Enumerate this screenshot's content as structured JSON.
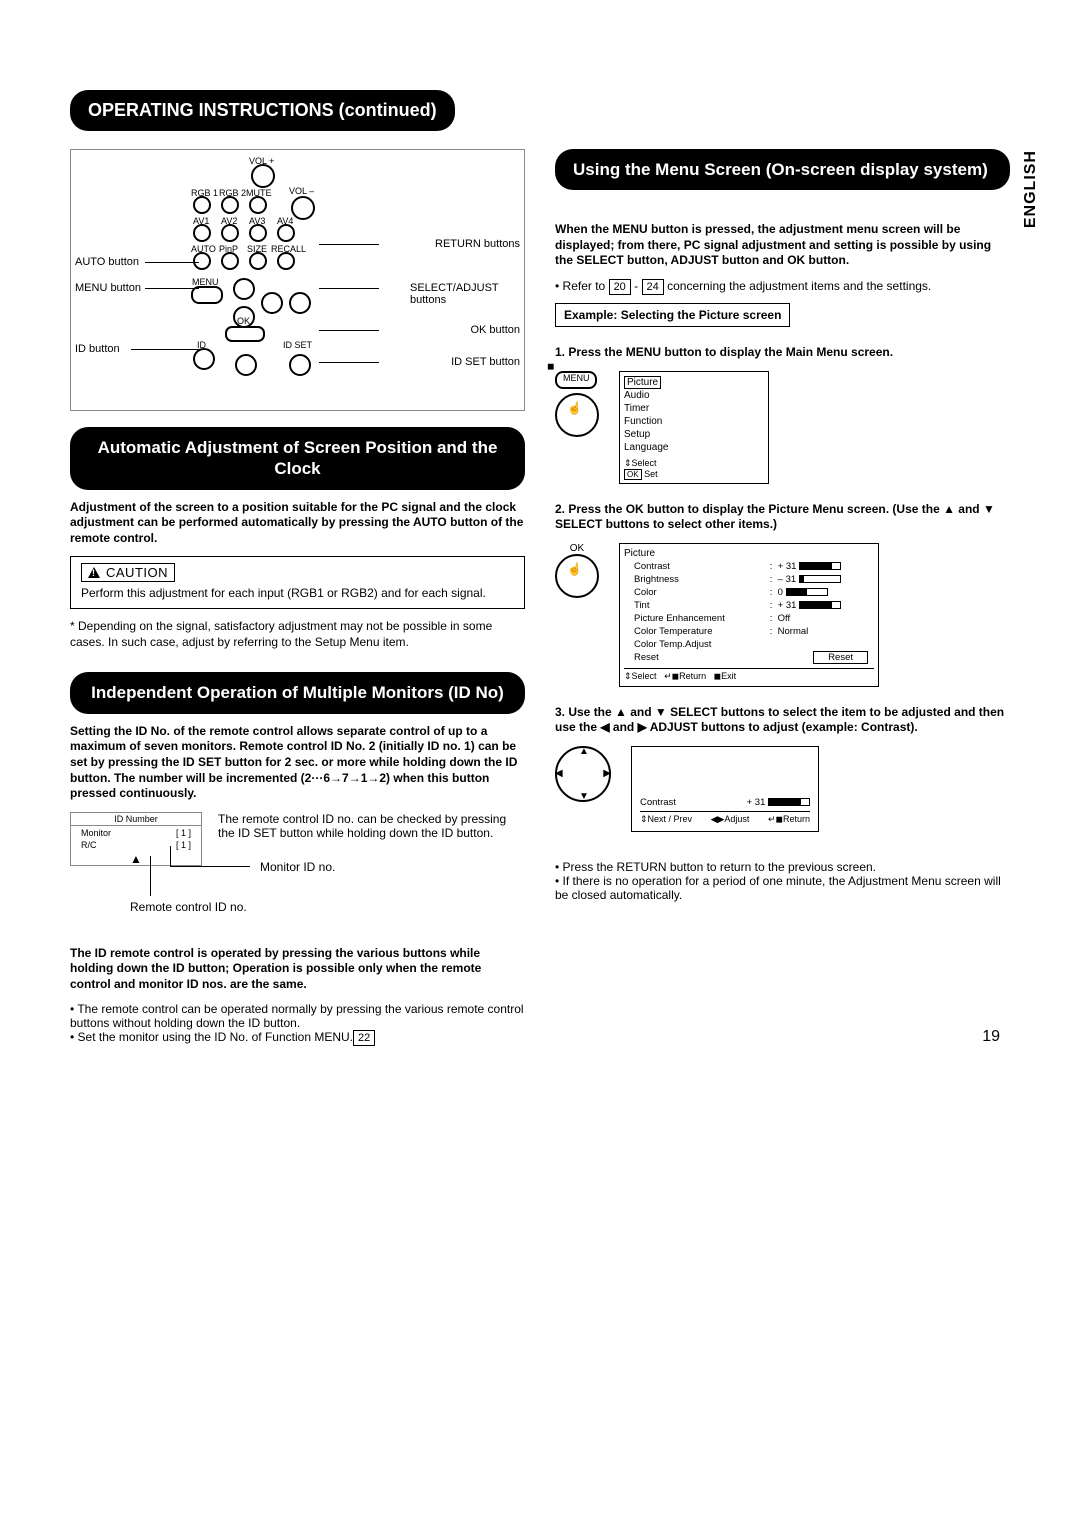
{
  "title": "OPERATING INSTRUCTIONS (continued)",
  "english_tab": "ENGLISH",
  "page_number": "19",
  "remote_labels": {
    "auto": "AUTO button",
    "menu": "MENU button",
    "id": "ID button",
    "return": "RETURN buttons",
    "select_adjust": "SELECT/ADJUST buttons",
    "ok": "OK button",
    "idset": "ID SET button",
    "btn_rgb1": "RGB 1",
    "btn_rgb2": "RGB 2",
    "btn_mute": "MUTE",
    "btn_av1": "AV1",
    "btn_av2": "AV2",
    "btn_av3": "AV3",
    "btn_av4": "AV4",
    "btn_auto": "AUTO",
    "btn_pinp": "PinP",
    "btn_size": "SIZE",
    "btn_recall": "RECALL",
    "btn_volp": "VOL +",
    "btn_volm": "VOL –",
    "btn_menu": "MENU",
    "btn_ok": "OK",
    "btn_id": "ID",
    "btn_idset": "ID SET"
  },
  "section_auto": {
    "heading": "Automatic Adjustment of Screen Position and the Clock",
    "intro": "Adjustment of the screen to a position suitable for the PC signal and the clock adjustment can be performed automatically by pressing the AUTO button of the remote control.",
    "caution_label": "CAUTION",
    "caution_body": "Perform this adjustment for each input (RGB1 or RGB2) and for each signal.",
    "note": "* Depending on the signal, satisfactory adjustment may not be possible in some cases. In such case, adjust by referring to the Setup Menu item."
  },
  "section_id": {
    "heading": "Independent Operation of Multiple Monitors (ID No)",
    "body1": "Setting the ID No. of the remote control allows separate control of up to a maximum of seven monitors. Remote control ID No. 2 (initially ID no. 1) can be set by pressing the ID SET button for 2 sec. or more while holding down the ID button.  The number will be incremented (2···6→7→1→2) when this button pressed continuously.",
    "check_text": "The remote control ID no. can be checked by pressing the ID SET button while holding down the ID button.",
    "idbox": {
      "title": "ID Number",
      "monitor": "Monitor",
      "rc": "R/C",
      "mval": "[ 1 ]",
      "rval": "[ 1 ]"
    },
    "mon_label": "Monitor ID no.",
    "rc_label": "Remote control ID no.",
    "body2": "The ID remote control is operated by pressing the various buttons while holding down the ID button; Operation is possible only when the remote control and monitor ID nos. are the same.",
    "bullet1": "The remote control can be operated normally by pressing the various remote control buttons without holding down the ID button.",
    "bullet2a": "Set the monitor using the ID No. of Function MENU.",
    "bullet2_ref": "22"
  },
  "section_menu": {
    "heading": "Using the Menu Screen (On-screen display system)",
    "intro": "When the MENU button is pressed, the adjustment menu screen will be displayed; from there, PC signal adjustment and setting is possible by using the SELECT button, ADJUST button and OK button.",
    "refer_a": "• Refer to ",
    "ref1": "20",
    "ref_dash": " - ",
    "ref2": "24",
    "refer_b": " concerning the adjustment items and the settings.",
    "example": "Example: Selecting the Picture screen",
    "step1": "1. Press the MENU button to display the Main Menu screen.",
    "menu_label": "MENU",
    "main_menu": [
      "Picture",
      "Audio",
      "Timer",
      "Function",
      "Setup",
      "Language"
    ],
    "main_footer_select": "Select",
    "main_footer_ok": "OK",
    "main_footer_set": " Set",
    "step2": "2. Press the OK button to display the Picture Menu screen. (Use the ▲ and ▼ SELECT buttons to select other items.)",
    "ok_label": "OK",
    "picture_menu": {
      "title": "Picture",
      "rows": [
        {
          "l": "Contrast",
          "v": "+ 31",
          "bar": 0.8
        },
        {
          "l": "Brightness",
          "v": "– 31",
          "bar": 0.1
        },
        {
          "l": "Color",
          "v": "0",
          "bar": 0.5
        },
        {
          "l": "Tint",
          "v": "+ 31",
          "bar": 0.8
        },
        {
          "l": "Picture Enhancement",
          "v": "Off"
        },
        {
          "l": "Color Temperature",
          "v": "Normal"
        },
        {
          "l": "Color Temp.Adjust",
          "v": ""
        },
        {
          "l": "Reset",
          "v": "",
          "reset": true
        }
      ],
      "footer_select": "Select",
      "footer_return": "Return",
      "footer_exit": "Exit"
    },
    "step3": "3. Use the ▲ and ▼ SELECT buttons to select the item to be adjusted and then use the ◀ and ▶ ADJUST buttons to adjust (example: Contrast).",
    "contrast_screen": {
      "label": "Contrast",
      "value": "+ 31",
      "np": "Next / Prev",
      "adj": "Adjust",
      "ret": "Return"
    },
    "tail1": "• Press the RETURN button to return to the previous screen.",
    "tail2": "• If there is no operation for a period of one minute, the Adjustment Menu screen will be closed automatically."
  }
}
